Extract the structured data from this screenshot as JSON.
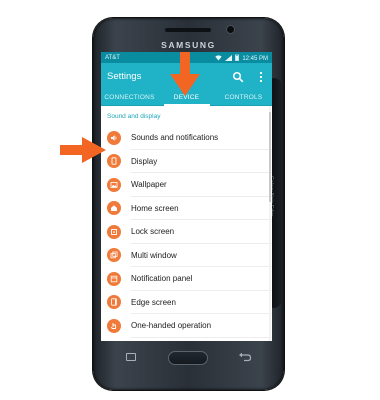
{
  "device": {
    "brand": "SAMSUNG",
    "edge_label": "Galaxy Note Edge"
  },
  "status_bar": {
    "carrier": "AT&T",
    "time": "12:45 PM"
  },
  "app_bar": {
    "title": "Settings",
    "icons": [
      "search-icon",
      "more-options-icon"
    ]
  },
  "tabs": [
    {
      "label": "CONNECTIONS",
      "active": false
    },
    {
      "label": "DEVICE",
      "active": true
    },
    {
      "label": "CONTROLS",
      "active": false
    }
  ],
  "section_header": "Sound and display",
  "items": [
    {
      "label": "Sounds and notifications",
      "icon": "speaker-icon"
    },
    {
      "label": "Display",
      "icon": "display-icon"
    },
    {
      "label": "Wallpaper",
      "icon": "wallpaper-icon"
    },
    {
      "label": "Home screen",
      "icon": "home-screen-icon"
    },
    {
      "label": "Lock screen",
      "icon": "lock-screen-icon"
    },
    {
      "label": "Multi window",
      "icon": "multi-window-icon"
    },
    {
      "label": "Notification panel",
      "icon": "notification-panel-icon"
    },
    {
      "label": "Edge screen",
      "icon": "edge-screen-icon"
    },
    {
      "label": "One-handed operation",
      "icon": "one-handed-icon"
    }
  ],
  "colors": {
    "accent": "#20b3c7",
    "status_bar": "#0a8ca0",
    "icon_orange": "#f07a3a",
    "arrow_orange": "#f26522"
  }
}
